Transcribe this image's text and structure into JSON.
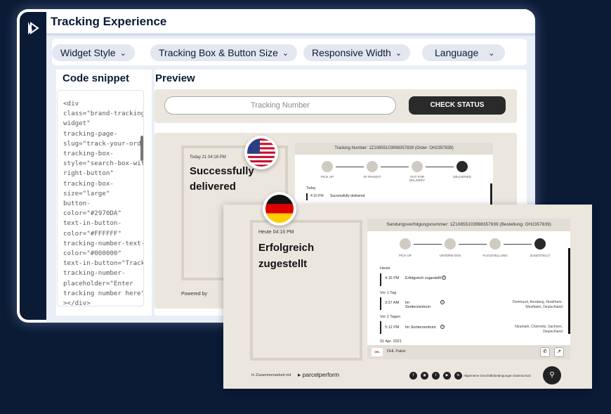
{
  "app": {
    "title": "Tracking Experience"
  },
  "tabs": [
    {
      "label": "Widget Style"
    },
    {
      "label": "Tracking Box & Button Size"
    },
    {
      "label": "Responsive Width"
    },
    {
      "label": "Language"
    }
  ],
  "code_panel": {
    "title": "Code snippet",
    "code": "<div\nclass=\"brand-tracking-\nwidget\"\ntracking-page-\nslug=\"track-your-order\"\ntracking-box-\nstyle=\"search-box-with-\nright-button\"\ntracking-box-\nsize=\"large\"\nbutton-\ncolor=\"#2970DA\"\ntext-in-button-\ncolor=\"#FFFFFF\"\ntracking-number-text-\ncolor=\"#000000\"\ntext-in-button=\"Track\"\ntracking-number-\nplaceholder=\"Enter\ntracking number here\"\n></div>"
  },
  "preview": {
    "title": "Preview",
    "tracking_placeholder": "Tracking Number",
    "check_button": "CHECK STATUS"
  },
  "us_widget": {
    "date": "Today 21 04:16 PM",
    "status_line1": "Successfully",
    "status_line2": "delivered",
    "powered_by": "Powered by",
    "header": "Tracking Number: 1Z10855103998357839 (Order: OH2357839)",
    "steps": [
      "PICK UP",
      "IN TRANSIT",
      "OUT FOR DELIVERY",
      "DELIVERED"
    ],
    "section": "Today",
    "event_time": "4:16 PM",
    "event_text": "Successfully delivered"
  },
  "de_widget": {
    "date": "Heute 04:16 PM",
    "status_line1": "Erfolgreich",
    "status_line2": "zugestellt",
    "header": "Sendungsverfolgungsnummer: 1Z10855103998357839 (Bestellung: OH2357839)",
    "steps": [
      "PICK UP",
      "UNTERW EGS",
      "IN ZUSTELLUNG",
      "ZUGESTELLT"
    ],
    "timeline": [
      {
        "section": "Heute",
        "time": "4:16 PM",
        "text": "Erfolgreich zugestellt",
        "location": ""
      },
      {
        "section": "Vor 1 Tag",
        "time": "3:37 AM",
        "text": "Im Sortierzentrum",
        "location": "Dortmund, Arnsberg, Nordrhein-Westfalen, Deutschland"
      },
      {
        "section": "Vor 2 Tagen",
        "time": "5:12 PM",
        "text": "Im Sortierzentrum",
        "location": "Neumark, Chemnitz, Sachsen, Deutschland"
      }
    ],
    "next_section": "01 Apr. 2021",
    "carrier": "DHL Paket",
    "carrier_logo": "DHL",
    "partnership": "In Zusammenarbeit mit",
    "brand": "parcelperform",
    "links": "Allgemeine Geschäftsbedingungen   Datenschutz",
    "social_icons": [
      "facebook-icon",
      "instagram-icon",
      "twitter-icon",
      "youtube-icon",
      "linkedin-icon"
    ]
  },
  "colors": {
    "navy": "#0b1b36",
    "button_dark": "#2a2a2a",
    "card_bg": "#ebe7df"
  }
}
